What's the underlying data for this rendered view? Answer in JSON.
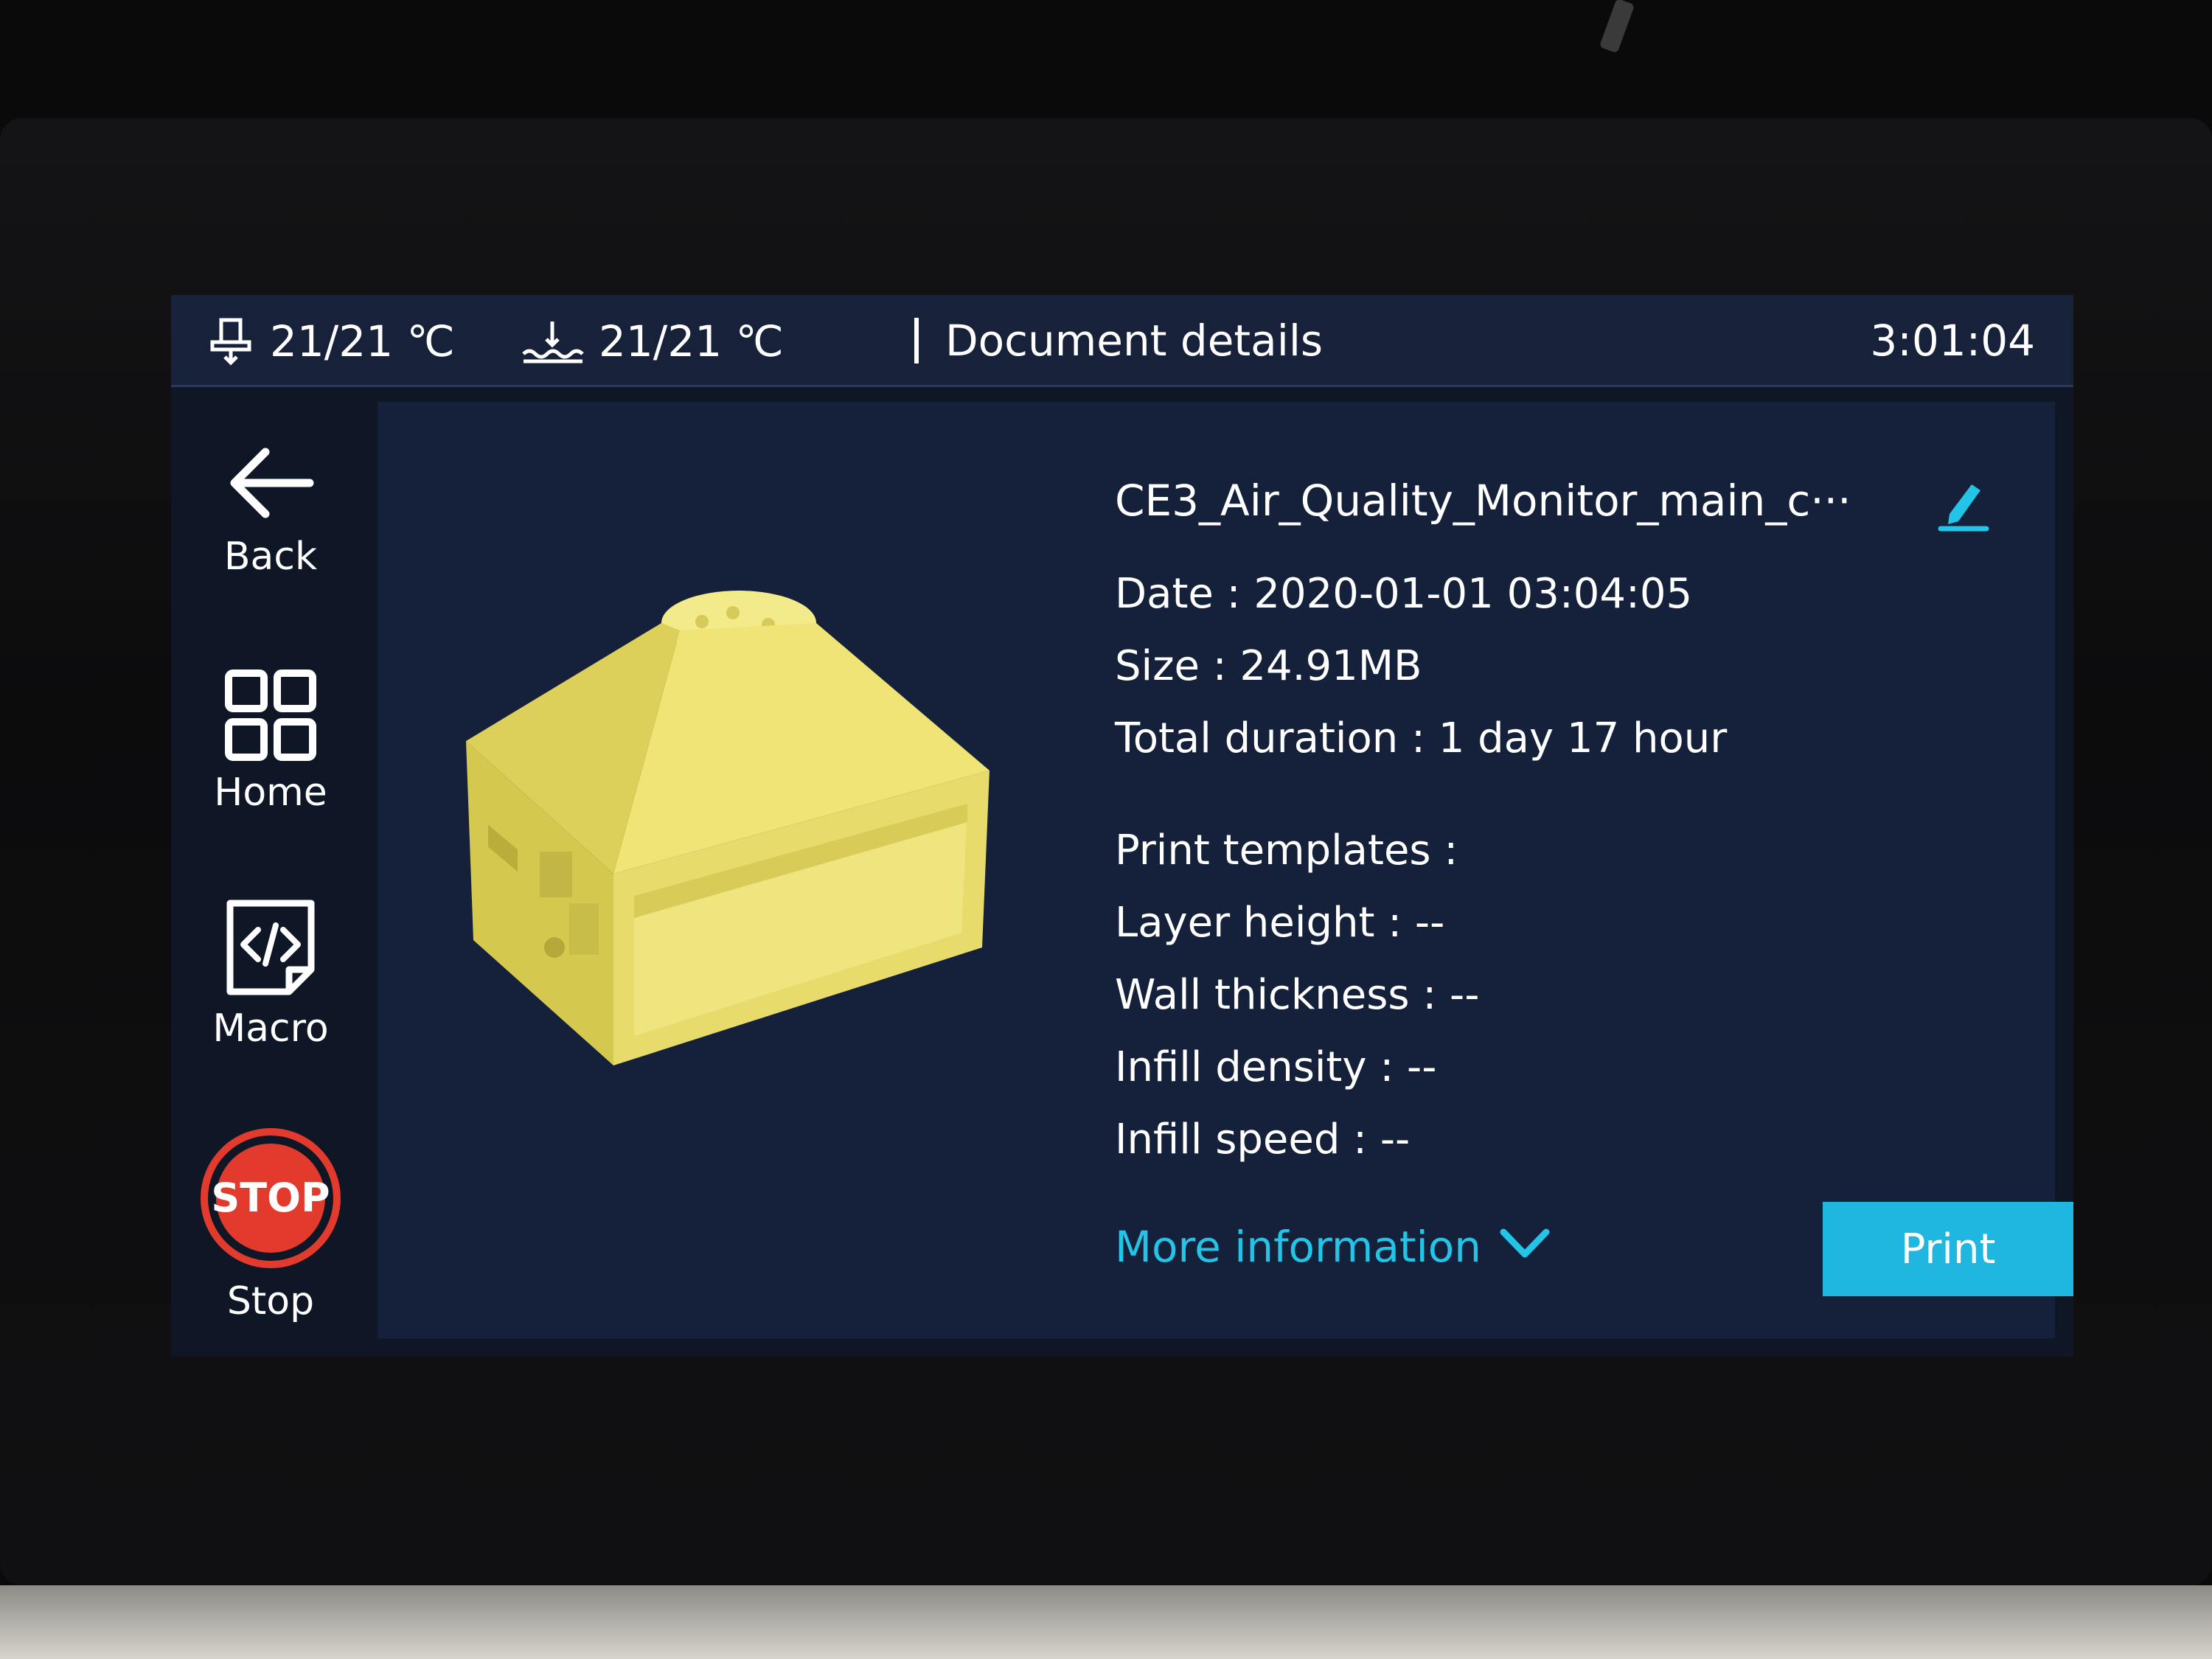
{
  "status_bar": {
    "nozzle_temp": "21/21 ℃",
    "bed_temp": "21/21 ℃",
    "title": "Document details",
    "clock": "3:01:04",
    "nozzle_icon": "nozzle-temperature-icon",
    "bed_icon": "bed-temperature-icon"
  },
  "sidebar": {
    "items": [
      {
        "label": "Back",
        "icon": "back-arrow-icon"
      },
      {
        "label": "Home",
        "icon": "grid-icon"
      },
      {
        "label": "Macro",
        "icon": "code-document-icon"
      },
      {
        "label": "Stop",
        "icon": "stop-sign-icon",
        "icon_text": "STOP"
      }
    ]
  },
  "document": {
    "filename": "CE3_Air_Quality_Monitor_main_c···",
    "date": "Date : 2020-01-01 03:04:05",
    "size": "Size : 24.91MB",
    "duration": "Total duration : 1 day 17 hour",
    "templates_heading": "Print templates :",
    "layer_height": "Layer height : --",
    "wall_thickness": "Wall thickness : --",
    "infill_density": "Infill density : --",
    "infill_speed": "Infill speed : --"
  },
  "actions": {
    "more_information": "More information",
    "print": "Print"
  },
  "colors": {
    "accent": "#1fb6df",
    "link": "#22c4e8",
    "stop": "#e23a2c",
    "model": "#e6d85a",
    "panel": "#15213a",
    "background": "#0f1727"
  }
}
